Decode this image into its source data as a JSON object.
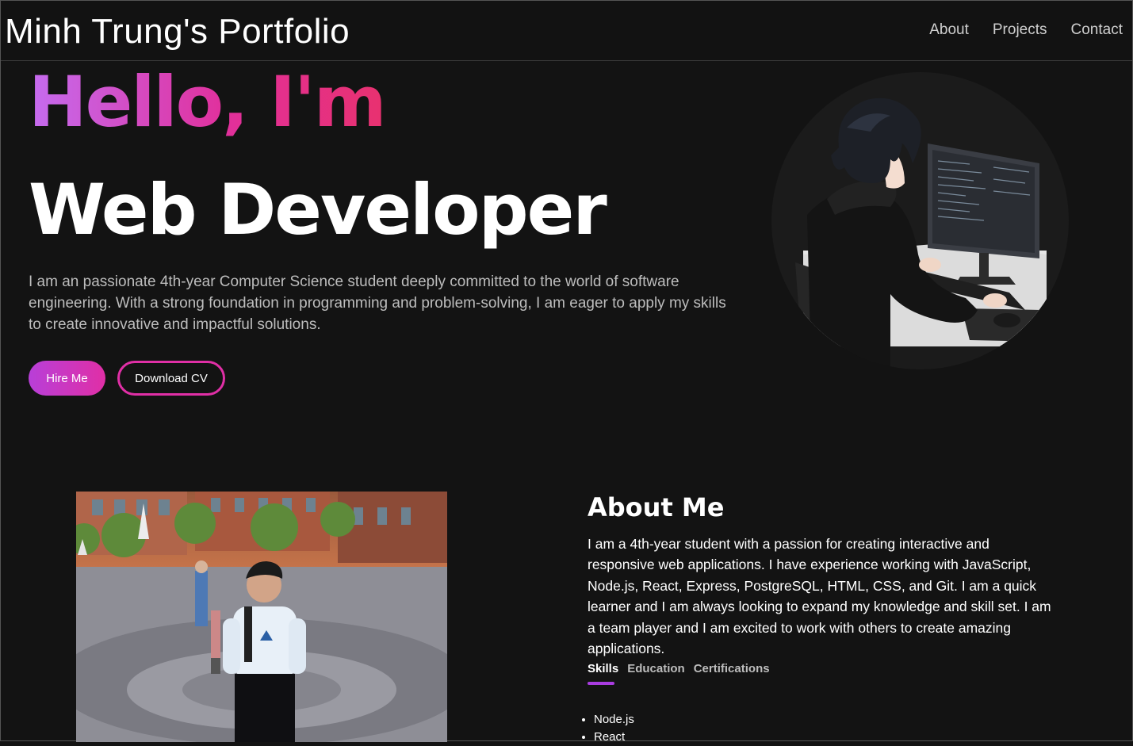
{
  "header": {
    "brand": "Minh Trung's Portfolio",
    "nav": [
      "About",
      "Projects",
      "Contact"
    ]
  },
  "hero": {
    "greeting": "Hello, I'm",
    "role": "Web Developer",
    "intro": "I am an passionate 4th-year Computer Science student deeply committed to the world of software engineering. With a strong foundation in programming and problem-solving, I am eager to apply my skills to create innovative and impactful solutions.",
    "hire_label": "Hire Me",
    "cv_label": "Download CV"
  },
  "about": {
    "title": "About Me",
    "text": "I am a 4th-year student with a passion for creating interactive and responsive web applications. I have experience working with JavaScript, Node.js, React, Express, PostgreSQL, HTML, CSS, and Git. I am a quick learner and I am always looking to expand my knowledge and skill set. I am a team player and I am excited to work with others to create amazing applications.",
    "tabs": [
      "Skills",
      "Education",
      "Certifications"
    ],
    "active_tab": "Skills",
    "skills": [
      "Node.js",
      "React"
    ]
  },
  "colors": {
    "background": "#131313",
    "accent_purple": "#b83fd8",
    "accent_pink": "#e02fa6"
  },
  "icons": [
    "avatar-illustration",
    "profile-photo"
  ]
}
